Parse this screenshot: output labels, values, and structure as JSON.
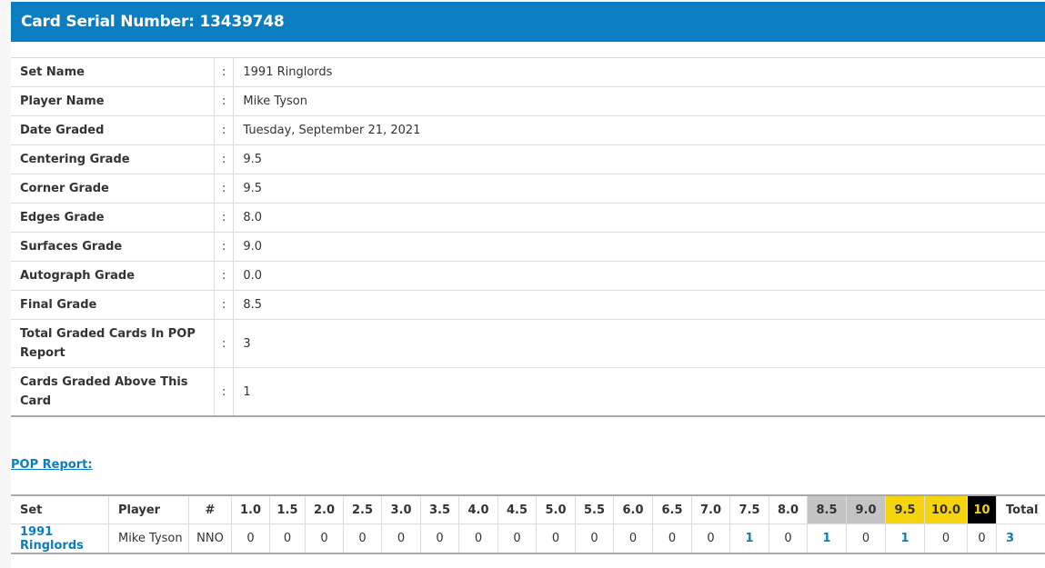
{
  "header": {
    "title": "Card Serial Number: 13439748"
  },
  "details": {
    "separator": ":",
    "rows": [
      {
        "label": "Set Name",
        "value": "1991 Ringlords"
      },
      {
        "label": "Player Name",
        "value": "Mike Tyson"
      },
      {
        "label": "Date Graded",
        "value": "Tuesday, September 21, 2021"
      },
      {
        "label": "Centering Grade",
        "value": "9.5"
      },
      {
        "label": "Corner Grade",
        "value": "9.5"
      },
      {
        "label": "Edges Grade",
        "value": "8.0"
      },
      {
        "label": "Surfaces Grade",
        "value": "9.0"
      },
      {
        "label": "Autograph Grade",
        "value": "0.0"
      },
      {
        "label": "Final Grade",
        "value": "8.5"
      },
      {
        "label": "Total Graded Cards In POP Report",
        "value": "3"
      },
      {
        "label": "Cards Graded Above This Card",
        "value": "1"
      }
    ]
  },
  "pop": {
    "link_label": "POP Report:",
    "columns": [
      "Set",
      "Player",
      "#",
      "1.0",
      "1.5",
      "2.0",
      "2.5",
      "3.0",
      "3.5",
      "4.0",
      "4.5",
      "5.0",
      "5.5",
      "6.0",
      "6.5",
      "7.0",
      "7.5",
      "8.0",
      "8.5",
      "9.0",
      "9.5",
      "10.0",
      "10",
      "Total"
    ],
    "row": [
      "1991 Ringlords",
      "Mike Tyson",
      "NNO",
      "0",
      "0",
      "0",
      "0",
      "0",
      "0",
      "0",
      "0",
      "0",
      "0",
      "0",
      "0",
      "0",
      "1",
      "0",
      "1",
      "0",
      "1",
      "0",
      "0",
      "3"
    ],
    "highlight_colors": {
      "silver": "#c4c4c4",
      "gold": "#f5d40b",
      "black": "#000000"
    }
  },
  "colors": {
    "accent": "#0b7dc1"
  }
}
